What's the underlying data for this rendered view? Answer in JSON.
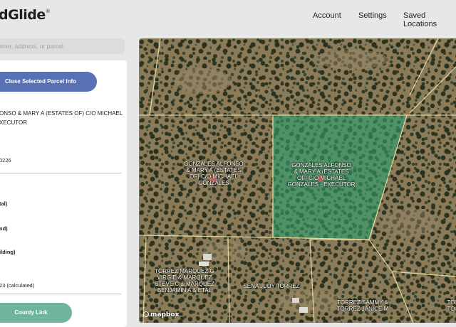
{
  "header": {
    "logo_text": "dGlide",
    "logo_mark": "®",
    "nav": [
      {
        "label": "Account"
      },
      {
        "label": "Settings"
      },
      {
        "label": "Saved Locations"
      }
    ]
  },
  "search": {
    "placeholder": "wner, address, or parcel"
  },
  "panel": {
    "close_button": "Close Selected Parcel Info",
    "owner_text": "ONSO & MARY A (ESTATES OF) C/O MICHAEL XECUTOR",
    "parcel_id": "0226",
    "label_total": "tal)",
    "label_land": "nd)",
    "label_building": "ilding)",
    "acres_text": "23 (calculated)",
    "county_button": "County Link"
  },
  "map": {
    "attribution": "mapbox",
    "selected_fill": "#2f9e6e",
    "boundary_color": "#e8d9a0",
    "parcels": [
      {
        "lines": [
          "GONZALES ALFONSO",
          "& MARY A (ESTATES",
          "OF) C/O MICHAEL",
          "GONZALES"
        ]
      },
      {
        "lines": [
          "GONZALES ALFONSO",
          "& MARY A (ESTATES",
          "OF) C/O MICHAEL",
          "GONZALES - EXECUTOR"
        ]
      },
      {
        "lines": [
          "TORREZ MARQUEZ G",
          "VIRGIE & MARQUEZ",
          "STEVE C & MARQUEZ",
          "BENJAMIN A & ETAL"
        ]
      },
      {
        "lines": [
          "SENA JUDY TORREZ"
        ]
      },
      {
        "lines": [
          "TORREZ SAMMY &",
          "TORREZ JANICE M"
        ]
      },
      {
        "lines": [
          "TO",
          "TO"
        ]
      }
    ]
  }
}
